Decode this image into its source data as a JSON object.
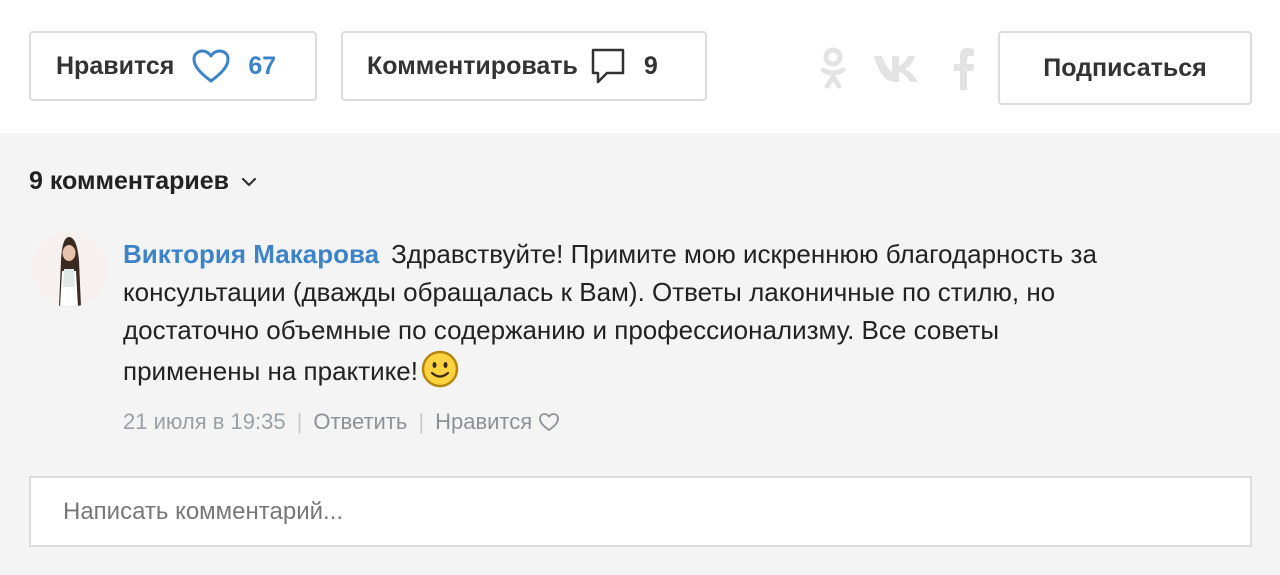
{
  "actions": {
    "like_label": "Нравится",
    "like_count": "67",
    "comment_label": "Комментировать",
    "comment_count": "9",
    "subscribe_label": "Подписаться"
  },
  "social": [
    "odnoklassniki-icon",
    "vk-icon",
    "facebook-icon"
  ],
  "comments": {
    "heading": "9 комментариев",
    "items": [
      {
        "author": "Виктория Макарова",
        "text": "Здравствуйте! Примите мою искреннюю благодарность за консультации (дважды обращалась к Вам). Ответы лаконичные по стилю, но достаточно объемные по содержанию и профессионализму. Все советы применены на практике!",
        "date": "21 июля в 19:35",
        "reply_label": "Ответить",
        "like_label": "Нравится"
      }
    ]
  },
  "composer": {
    "placeholder": "Написать комментарий..."
  },
  "colors": {
    "accent": "#3d83c8",
    "muted": "#9aa0a6",
    "border": "#dcdcdc",
    "background": "#f4f4f4"
  }
}
